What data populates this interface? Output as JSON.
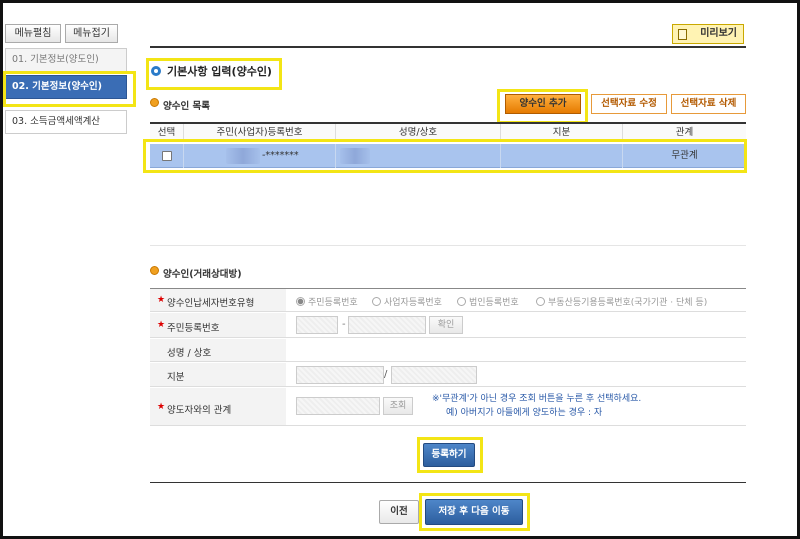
{
  "sidebar": {
    "expand_label": "메뉴펼침",
    "collapse_label": "메뉴접기",
    "items": [
      {
        "label": "01. 기본정보(양도인)"
      },
      {
        "label": "02. 기본정보(양수인)"
      },
      {
        "label": "03. 소득금액세액계산"
      }
    ]
  },
  "toolbar": {
    "preview_label": "미리보기"
  },
  "main": {
    "section_title": "기본사항 입력(양수인)",
    "list_title": "양수인 목록",
    "buttons": {
      "add": "양수인 추가",
      "edit": "선택자료 수정",
      "delete": "선택자료 삭제"
    },
    "table": {
      "headers": [
        "선택",
        "주민(사업자)등록번호",
        "성명/상호",
        "지분",
        "관계"
      ],
      "rows": [
        {
          "id_masked": "-*******",
          "name": "",
          "share": "",
          "relation": "무관계"
        }
      ]
    }
  },
  "form": {
    "title": "양수인(거래상대방)",
    "rows": {
      "tax_id_type": {
        "label": "양수인납세자번호유형",
        "options": [
          "주민등록번호",
          "사업자등록번호",
          "법인등록번호",
          "부동산등기용등록번호(국가기관 · 단체 등)"
        ],
        "selected": "주민등록번호"
      },
      "resident_no": {
        "label": "주민등록번호",
        "separator": "-",
        "confirm": "확인"
      },
      "name": {
        "label": "성명 / 상호"
      },
      "share": {
        "label": "지분",
        "separator": "/"
      },
      "relation": {
        "label": "양도자와의 관계",
        "search": "조회",
        "note_line1": "※'무관계'가 아닌 경우 조회 버튼을 누른 후 선택하세요.",
        "note_line2": "예) 아버지가 아들에게 양도하는 경우 : 자"
      }
    },
    "register_label": "등록하기"
  },
  "footer": {
    "prev_label": "이전",
    "save_next_label": "저장 후 다음 이동"
  },
  "colors": {
    "accent": "#3a6db5",
    "highlight": "#f3e515",
    "orange": "#f08c00"
  }
}
